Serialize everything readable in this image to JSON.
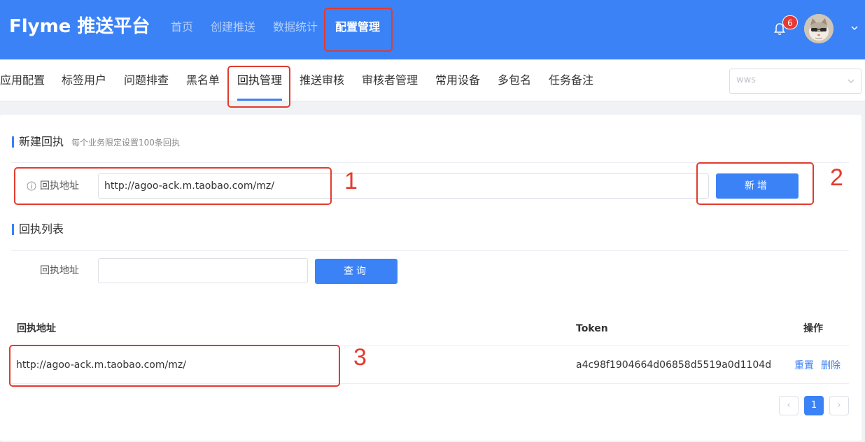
{
  "header": {
    "logo": "Flyme 推送平台",
    "nav": [
      {
        "label": "首页"
      },
      {
        "label": "创建推送"
      },
      {
        "label": "数据统计"
      },
      {
        "label": "配置管理",
        "active": true
      }
    ],
    "notification_count": "6"
  },
  "subnav": {
    "items": [
      {
        "label": "应用配置"
      },
      {
        "label": "标签用户"
      },
      {
        "label": "问题排查"
      },
      {
        "label": "黑名单"
      },
      {
        "label": "回执管理",
        "active": true
      },
      {
        "label": "推送审核"
      },
      {
        "label": "审核者管理"
      },
      {
        "label": "常用设备"
      },
      {
        "label": "多包名"
      },
      {
        "label": "任务备注"
      }
    ],
    "app_select": "wws"
  },
  "create_section": {
    "title": "新建回执",
    "hint": "每个业务限定设置100条回执",
    "label": "回执地址",
    "input_value": "http://agoo-ack.m.taobao.com/mz/",
    "add_button": "新增"
  },
  "list_section": {
    "title": "回执列表",
    "label": "回执地址",
    "input_value": "",
    "search_button": "查询"
  },
  "table": {
    "columns": [
      "回执地址",
      "Token",
      "操作"
    ],
    "rows": [
      {
        "url": "http://agoo-ack.m.taobao.com/mz/",
        "token": "a4c98f1904664d06858d5519a0d1104d",
        "actions": [
          "重置",
          "删除"
        ]
      }
    ]
  },
  "pagination": {
    "prev": "‹",
    "current": "1",
    "next": "›"
  },
  "annotations": [
    "1",
    "2",
    "3"
  ],
  "colors": {
    "primary": "#3b82f6",
    "annotation": "#e23b2e"
  }
}
